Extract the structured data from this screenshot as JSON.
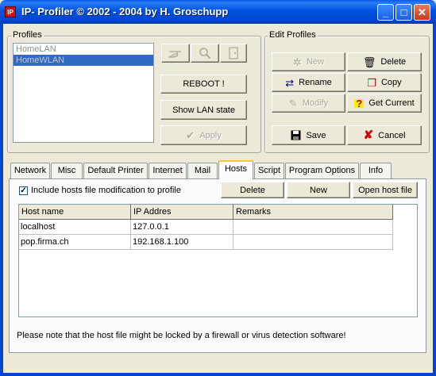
{
  "window": {
    "title": "IP- Profiler  © 2002 - 2004 by H. Groschupp",
    "icon_label": "IP",
    "controls": {
      "minimize": "_",
      "maximize": "□",
      "close": "✕"
    }
  },
  "profiles": {
    "group_label": "Profiles",
    "items": [
      {
        "label": "HomeLAN",
        "selected": false
      },
      {
        "label": "HomeWLAN",
        "selected": true
      }
    ],
    "reboot_label": "REBOOT !",
    "show_lan_label": "Show LAN state",
    "apply_label": "Apply"
  },
  "edit_profiles": {
    "group_label": "Edit Profiles",
    "new_label": "New",
    "delete_label": "Delete",
    "rename_label": "Rename",
    "copy_label": "Copy",
    "modify_label": "Modify",
    "get_current_label": "Get Current",
    "save_label": "Save",
    "cancel_label": "Cancel"
  },
  "tabs": [
    "Network",
    "Misc",
    "Default Printer",
    "Internet",
    "Mail",
    "Hosts",
    "Script",
    "Program Options",
    "Info"
  ],
  "active_tab": "Hosts",
  "hosts": {
    "include_label": "Include hosts file modification to profile",
    "include_checked": true,
    "delete_label": "Delete",
    "new_label": "New",
    "open_label": "Open host file",
    "columns": [
      "Host name",
      "IP Addres",
      "Remarks"
    ],
    "rows": [
      {
        "host": "localhost",
        "ip": "127.0.0.1",
        "remarks": ""
      },
      {
        "host": "pop.firma.ch",
        "ip": "192.168.1.100",
        "remarks": ""
      }
    ],
    "note": "Please note that the host file might be locked by a firewall or virus detection software!"
  },
  "colors": {
    "titlebar": "#0054e3",
    "selection": "#316ac5",
    "tab_highlight": "#ffc83c"
  }
}
